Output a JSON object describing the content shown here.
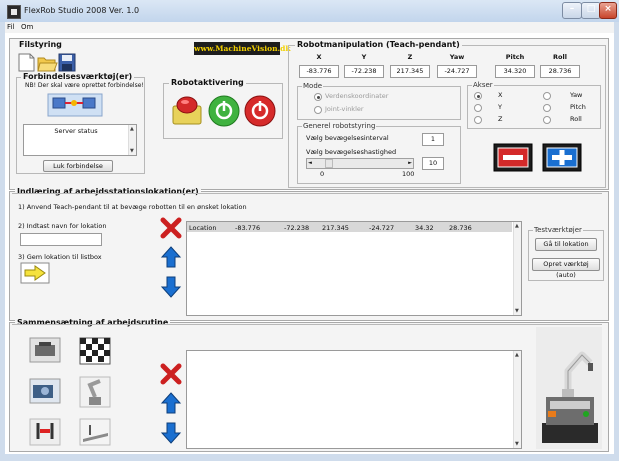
{
  "window": {
    "title": "FlexRob Studio 2008 Ver. 1.0"
  },
  "menu": {
    "file": "Fil",
    "about": "Om"
  },
  "filstyring": {
    "title": "Filstyring"
  },
  "watermark": "www.MachineVision.dk",
  "connection": {
    "title": "Forbindelsesværktøj(er)",
    "note": "NB! Der skal være oprettet forbindelse!",
    "status": "Server status",
    "close_button": "Luk forbindelse"
  },
  "activation": {
    "title": "Robotaktivering"
  },
  "manipulation": {
    "title": "Robotmanipulation (Teach-pendant)",
    "headers": [
      "X",
      "Y",
      "Z",
      "Yaw",
      "Pitch",
      "Roll"
    ],
    "values": [
      "-83.776",
      "-72.238",
      "217.345",
      "-24.727",
      "34.320",
      "28.736"
    ],
    "mode": {
      "title": "Mode",
      "options": [
        "Verdenskoordinater",
        "Joint-vinkler"
      ],
      "selected": 0
    },
    "general": {
      "title": "Generel robotstyring",
      "interval_label": "Vælg bevægelsesinterval",
      "interval_value": "1",
      "speed_label": "Vælg bevægelseshastighed",
      "speed_value": "10",
      "slider_min": "0",
      "slider_max": "100",
      "slider_level": 10
    },
    "axes": {
      "title": "Akser",
      "left": [
        "X",
        "Y",
        "Z"
      ],
      "right": [
        "Yaw",
        "Pitch",
        "Roll"
      ],
      "selected_left": 0
    }
  },
  "location": {
    "title": "Indlæring af arbejdsstationslokation(er)",
    "step1": "1) Anvend Teach-pendant til at bevæge robotten til en ønsket lokation",
    "step2": "2) Indtast navn for lokation",
    "step3": "3) Gem lokation til listbox",
    "row": [
      "Location",
      "-83.776",
      "-72.238",
      "217.345",
      "-24.727",
      "34.32",
      "28.736"
    ],
    "test_tools": {
      "title": "Testværktøjer",
      "goto_button": "Gå til lokation",
      "create_button": "Opret værktøj (auto)"
    }
  },
  "routine": {
    "title": "Sammensætning af arbejdsrutine"
  },
  "colors": {
    "accent_red": "#cc2020",
    "accent_blue": "#1a6fd0",
    "panel_bg": "#f4f4f4"
  }
}
